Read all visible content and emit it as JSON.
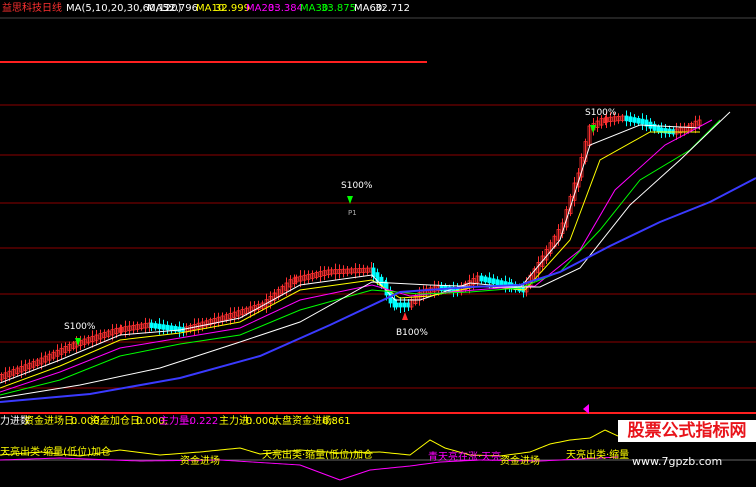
{
  "header": {
    "title": "益思科技日线",
    "ma_params": "MA(5,10,20,30,60,120)",
    "ma5_label": "MA5:",
    "ma5_value": "32.796",
    "ma10_label": "MA10:",
    "ma10_value": "32.999",
    "ma20_label": "MA20:",
    "ma20_value": "33.384",
    "ma30_label": "MA30:",
    "ma30_value": "33.875",
    "ma60_label": "MA60:",
    "ma60_value": "32.712"
  },
  "indicator_bar": {
    "name": "力进数",
    "f1_label": "资金进场日:",
    "f1_value": "0.000,",
    "f2_label": "资金加仓日:",
    "f2_value": "0.000,",
    "f3_label": "主力量:",
    "f3_value": "-0.222",
    "f4_label": "主力进:",
    "f4_value": "0.000,",
    "f5_label": "大盘资金进场:",
    "f5_value": "6.861"
  },
  "annotations": {
    "s100_left": "S100%",
    "s100_mid": "S100%",
    "s100_mid_sub": "P1",
    "b100": "B100%",
    "s100_right": "S100%"
  },
  "signals": [
    {
      "text": "天亮出类·缩量(低位)加仓"
    },
    {
      "text": "资金进场"
    },
    {
      "text": "天亮出类·缩量(低位)加仓"
    },
    {
      "text": "青天亮在涨·天亮"
    },
    {
      "text": "资金进场"
    },
    {
      "text": "天亮出类·缩量"
    }
  ],
  "watermark": {
    "site_title": "股票公式指标网",
    "url": "www.7gpzb.com"
  },
  "colors": {
    "background": "#000000",
    "up_candle": "#ff3030",
    "down_candle": "#00ffff",
    "ma5": "#ffffff",
    "ma10": "#ffff00",
    "ma20": "#ff00ff",
    "ma30": "#00ff00",
    "ma60": "#ffffff",
    "ma120": "#3a3aff",
    "grid": "#8b0000",
    "signal_text": "#ffff00"
  },
  "chart_data": {
    "type": "line",
    "title": "益思科技日线",
    "series": [
      {
        "name": "MA5",
        "last": 32.796
      },
      {
        "name": "MA10",
        "last": 32.999
      },
      {
        "name": "MA20",
        "last": 33.384
      },
      {
        "name": "MA30",
        "last": 33.875
      },
      {
        "name": "MA60",
        "last": 32.712
      }
    ],
    "grid": true,
    "legend": "top"
  }
}
